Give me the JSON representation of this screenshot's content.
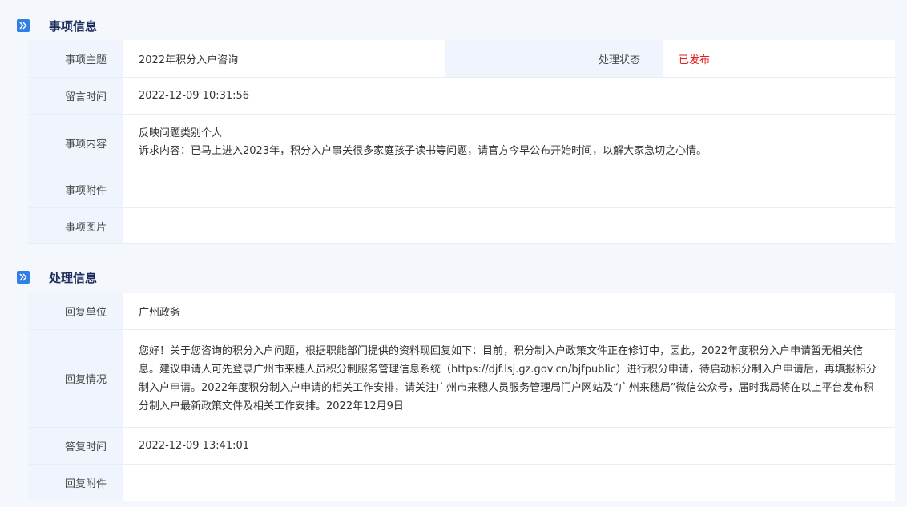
{
  "colors": {
    "accent": "#2f7fe6",
    "status": "#e02020",
    "title": "#1f2d5c"
  },
  "matter": {
    "title": "事项信息",
    "icon": "double-chevron-right-icon",
    "subject_label": "事项主题",
    "subject_value": "2022年积分入户咨询",
    "status_label": "处理状态",
    "status_value": "已发布",
    "time_label": "留言时间",
    "time_value": "2022-12-09 10:31:56",
    "content_label": "事项内容",
    "content_line1": "反映问题类别个人",
    "content_line2": "诉求内容：已马上进入2023年，积分入户事关很多家庭孩子读书等问题，请官方今早公布开始时间，以解大家急切之心情。",
    "attachment_label": "事项附件",
    "attachment_value": "",
    "image_label": "事项图片",
    "image_value": ""
  },
  "handling": {
    "title": "处理信息",
    "icon": "double-chevron-right-icon",
    "unit_label": "回复单位",
    "unit_value": "广州政务",
    "reply_label": "回复情况",
    "reply_value": "您好！关于您咨询的积分入户问题，根据职能部门提供的资料现回复如下：目前，积分制入户政策文件正在修订中，因此，2022年度积分入户申请暂无相关信息。建议申请人可先登录广州市来穗人员积分制服务管理信息系统（https://djf.lsj.gz.gov.cn/bjfpublic）进行积分申请，待启动积分制入户申请后，再填报积分制入户申请。2022年度积分制入户申请的相关工作安排，请关注广州市来穗人员服务管理局门户网站及“广州来穗局”微信公众号，届时我局将在以上平台发布积分制入户最新政策文件及相关工作安排。2022年12月9日",
    "reply_time_label": "答复时间",
    "reply_time_value": "2022-12-09 13:41:01",
    "reply_attachment_label": "回复附件",
    "reply_attachment_value": ""
  }
}
